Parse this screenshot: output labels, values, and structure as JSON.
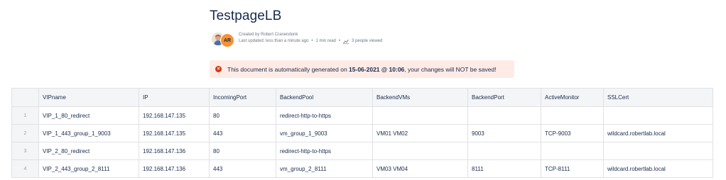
{
  "page": {
    "title": "TestpageLB",
    "byline": {
      "avatar_initials": "AR",
      "created_by_prefix": "Created by ",
      "author": "Robert Cranendonk",
      "last_updated": "Last updated: less than a minute ago",
      "read_time": "1 min read",
      "views": "3 people viewed"
    }
  },
  "banner": {
    "prefix": "This document is automatically generated on ",
    "timestamp": "15-06-2021 @ 10:06",
    "middle": ", your changes will ",
    "not": "NOT",
    "suffix": " be saved!",
    "color": "#ffebe6",
    "icon": "error-icon"
  },
  "table": {
    "columns": [
      "VIPname",
      "IP",
      "IncomingPort",
      "BackendPool",
      "BackendVMs",
      "BackendPort",
      "ActiveMonitor",
      "SSLCert"
    ],
    "rows": [
      {
        "num": "1",
        "cells": [
          "VIP_1_80_redirect",
          "192.168.147.135",
          "80",
          "redirect-http-to-https",
          "",
          "",
          "",
          ""
        ]
      },
      {
        "num": "2",
        "cells": [
          "VIP_1_443_group_1_9003",
          "192.168.147.135",
          "443",
          "vm_group_1_9003",
          "VM01 VM02",
          "9003",
          "TCP-9003",
          "wildcard.robertlab.local"
        ]
      },
      {
        "num": "3",
        "cells": [
          "VIP_2_80_redirect",
          "192.168.147.136",
          "80",
          "redirect-http-to-https",
          "",
          "",
          "",
          ""
        ]
      },
      {
        "num": "4",
        "cells": [
          "VIP_2_443_group_2_8111",
          "192.168.147.136",
          "443",
          "vm_group_2_8111",
          "VM03 VM04",
          "8111",
          "TCP-8111",
          "wildcard.robertlab.local"
        ]
      }
    ]
  }
}
